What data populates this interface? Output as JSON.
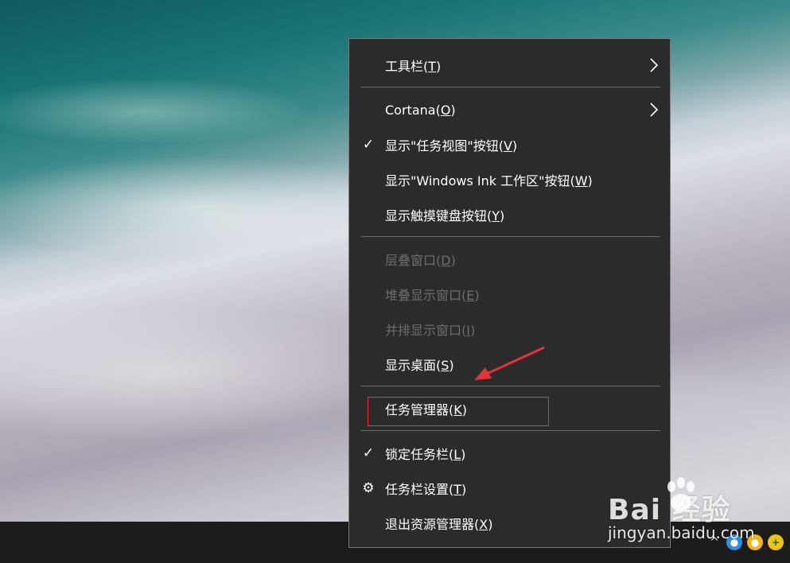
{
  "menu": {
    "items": [
      {
        "label": "工具栏(",
        "acc": "T",
        "tail": ")",
        "submenu": true,
        "check": "",
        "disabled": false
      },
      {
        "label": "Cortana(",
        "acc": "O",
        "tail": ")",
        "submenu": true,
        "check": "",
        "disabled": false
      },
      {
        "label": "显示\"任务视图\"按钮(",
        "acc": "V",
        "tail": ")",
        "submenu": false,
        "check": "✓",
        "disabled": false
      },
      {
        "label": "显示\"Windows Ink 工作区\"按钮(",
        "acc": "W",
        "tail": ")",
        "submenu": false,
        "check": "",
        "disabled": false
      },
      {
        "label": "显示触摸键盘按钮(",
        "acc": "Y",
        "tail": ")",
        "submenu": false,
        "check": "",
        "disabled": false
      },
      {
        "label": "层叠窗口(",
        "acc": "D",
        "tail": ")",
        "submenu": false,
        "check": "",
        "disabled": true
      },
      {
        "label": "堆叠显示窗口(",
        "acc": "E",
        "tail": ")",
        "submenu": false,
        "check": "",
        "disabled": true
      },
      {
        "label": "并排显示窗口(",
        "acc": "I",
        "tail": ")",
        "submenu": false,
        "check": "",
        "disabled": true
      },
      {
        "label": "显示桌面(",
        "acc": "S",
        "tail": ")",
        "submenu": false,
        "check": "",
        "disabled": false
      },
      {
        "label": "任务管理器(",
        "acc": "K",
        "tail": ")",
        "submenu": false,
        "check": "",
        "disabled": false
      },
      {
        "label": "锁定任务栏(",
        "acc": "L",
        "tail": ")",
        "submenu": false,
        "check": "✓",
        "disabled": false
      },
      {
        "label": "任务栏设置(",
        "acc": "T",
        "tail": ")",
        "submenu": false,
        "check": "⚙",
        "disabled": false
      },
      {
        "label": "退出资源管理器(",
        "acc": "X",
        "tail": ")",
        "submenu": false,
        "check": "",
        "disabled": false
      }
    ]
  },
  "tray": {
    "chevron": "^",
    "icons": [
      "app-icon-blue",
      "app-icon-yellow",
      "app-icon-green-plus"
    ]
  },
  "watermark": {
    "brand": "Bai  经验",
    "url": "jingyan.baidu.com"
  },
  "colors": {
    "menu_bg": "#2b2b2b",
    "menu_text": "#ffffff",
    "disabled_text": "#6d6d6d",
    "highlight": "#e2343a"
  }
}
